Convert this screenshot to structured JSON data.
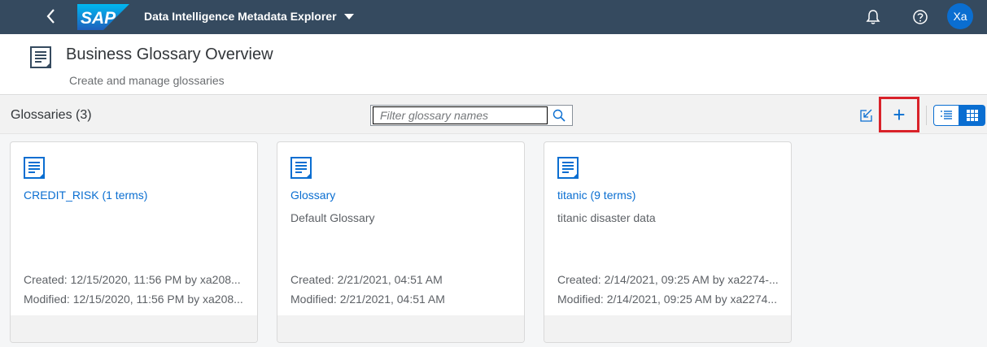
{
  "shell": {
    "app_title": "Data Intelligence Metadata Explorer",
    "logo_text": "SAP",
    "avatar_initials": "Xa",
    "icons": [
      "back-icon",
      "bell-icon",
      "help-icon"
    ]
  },
  "header": {
    "title": "Business Glossary Overview",
    "subtitle": "Create and manage glossaries"
  },
  "toolbar": {
    "count_label": "Glossaries (3)",
    "search_placeholder": "Filter glossary names",
    "search_value": "",
    "add_label": "+"
  },
  "glossaries": [
    {
      "title": "CREDIT_RISK (1 terms)",
      "description": "",
      "created": "Created: 12/15/2020, 11:56 PM by xa208...",
      "modified": "Modified: 12/15/2020, 11:56 PM by xa208..."
    },
    {
      "title": "Glossary",
      "description": "Default Glossary",
      "created": "Created: 2/21/2021, 04:51 AM",
      "modified": "Modified: 2/21/2021, 04:51 AM"
    },
    {
      "title": "titanic (9 terms)",
      "description": "titanic disaster data",
      "created": "Created: 2/14/2021, 09:25 AM by xa2274-...",
      "modified": "Modified: 2/14/2021, 09:25 AM by xa2274..."
    }
  ],
  "colors": {
    "shell": "#354a5f",
    "brand_blue": "#0a6ed1",
    "highlight": "#d9222a"
  }
}
